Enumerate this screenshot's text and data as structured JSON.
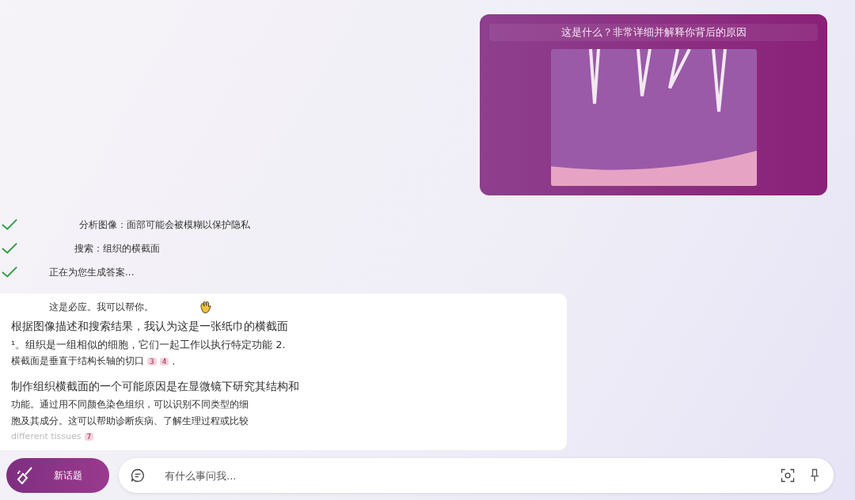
{
  "user_message": {
    "text": "这是什么？非常详细并解释你背后的原因"
  },
  "steps": [
    {
      "text": "分析图像：面部可能会被模糊以保护隐私",
      "done": true
    },
    {
      "text": "搜索：组织的横截面",
      "done": true
    },
    {
      "text": "正在为您生成答案...",
      "done": true
    }
  ],
  "answer": {
    "greeting": "这是必应。我可以帮你。",
    "lines": [
      {
        "kind": "large",
        "text": "根据图像描述和搜索结果，我认为这是一张纸巾的横截面"
      },
      {
        "kind": "medium",
        "text": "¹。组织是一组相似的细胞，它们一起工作以执行特定功能 2."
      },
      {
        "kind": "small",
        "text": "横截面是垂直于结构长轴的切口",
        "citations": [
          "3",
          "4"
        ],
        "tail": "."
      },
      {
        "kind": "gap"
      },
      {
        "kind": "large",
        "text": "制作组织横截面的一个可能原因是在显微镜下研究其结构和"
      },
      {
        "kind": "small",
        "text": "功能。通过用不同颜色染色组织，可以识别不同类型的细"
      },
      {
        "kind": "small",
        "text": "胞及其成分。这可以帮助诊断疾病、了解生理过程或比较"
      },
      {
        "kind": "faded",
        "text": "different tissues",
        "citations": [
          "7"
        ]
      }
    ]
  },
  "new_topic_button": {
    "label": "新话题"
  },
  "input": {
    "placeholder": "有什么事问我..."
  }
}
